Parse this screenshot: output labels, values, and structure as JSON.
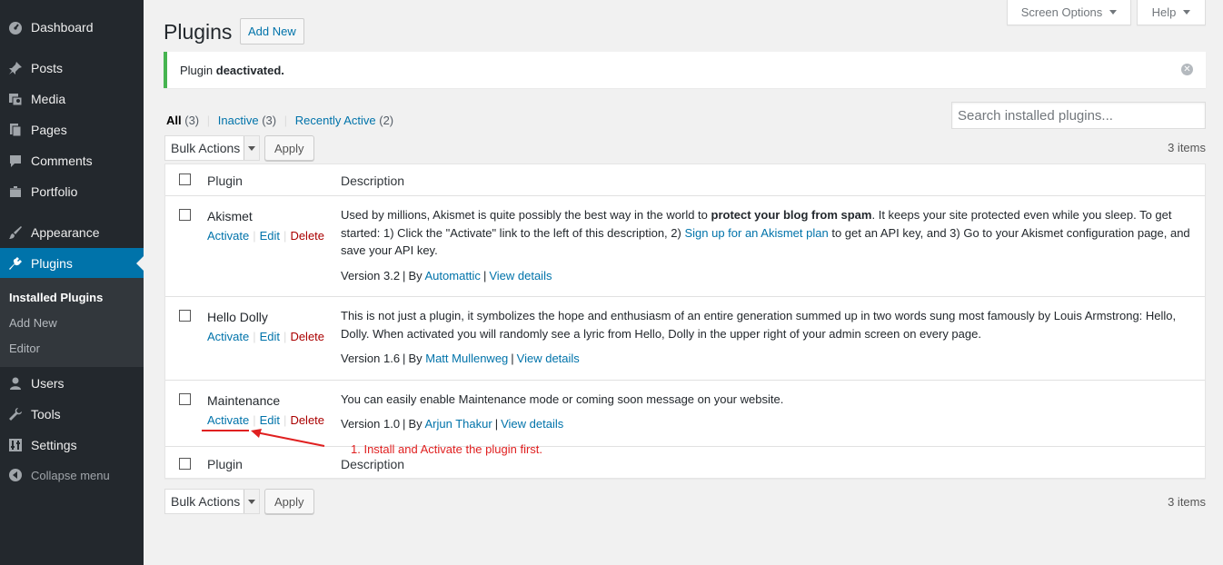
{
  "sidebar": {
    "items": [
      {
        "label": "Dashboard",
        "icon": "dashboard-icon"
      },
      {
        "label": "Posts",
        "icon": "pin-icon"
      },
      {
        "label": "Media",
        "icon": "media-icon"
      },
      {
        "label": "Pages",
        "icon": "pages-icon"
      },
      {
        "label": "Comments",
        "icon": "comments-icon"
      },
      {
        "label": "Portfolio",
        "icon": "portfolio-icon"
      },
      {
        "label": "Appearance",
        "icon": "brush-icon"
      },
      {
        "label": "Plugins",
        "icon": "plug-icon"
      },
      {
        "label": "Users",
        "icon": "users-icon"
      },
      {
        "label": "Tools",
        "icon": "wrench-icon"
      },
      {
        "label": "Settings",
        "icon": "settings-icon"
      },
      {
        "label": "Collapse menu",
        "icon": "collapse-icon"
      }
    ],
    "submenu": [
      "Installed Plugins",
      "Add New",
      "Editor"
    ]
  },
  "header": {
    "screen_options": "Screen Options",
    "help": "Help",
    "title": "Plugins",
    "add_new": "Add New"
  },
  "notice": {
    "prefix": "Plugin",
    "strong": "deactivated."
  },
  "filters": {
    "all": "All",
    "all_count": "(3)",
    "inactive": "Inactive",
    "inactive_count": "(3)",
    "recent": "Recently Active",
    "recent_count": "(2)",
    "sep": "|"
  },
  "search": {
    "placeholder": "Search installed plugins..."
  },
  "bulk": {
    "label": "Bulk Actions",
    "apply": "Apply",
    "items": "3 items"
  },
  "table": {
    "col_plugin": "Plugin",
    "col_description": "Description",
    "actions": {
      "activate": "Activate",
      "edit": "Edit",
      "delete": "Delete",
      "sep": "|"
    },
    "by": "By",
    "view_details": "View details",
    "plugins": [
      {
        "name": "Akismet",
        "desc_a": "Used by millions, Akismet is quite possibly the best way in the world to ",
        "desc_strong": "protect your blog from spam",
        "desc_b": ". It keeps your site protected even while you sleep. To get started: 1) Click the \"Activate\" link to the left of this description, 2) ",
        "desc_link": "Sign up for an Akismet plan",
        "desc_c": " to get an API key, and 3) Go to your Akismet configuration page, and save your API key.",
        "version": "Version 3.2",
        "author": "Automattic"
      },
      {
        "name": "Hello Dolly",
        "desc_a": "This is not just a plugin, it symbolizes the hope and enthusiasm of an entire generation summed up in two words sung most famously by Louis Armstrong: Hello, Dolly. When activated you will randomly see a lyric from Hello, Dolly in the upper right of your admin screen on every page.",
        "version": "Version 1.6",
        "author": "Matt Mullenweg"
      },
      {
        "name": "Maintenance",
        "desc_a": "You can easily enable Maintenance mode or coming soon message on your website.",
        "version": "Version 1.0",
        "author": "Arjun Thakur"
      }
    ]
  },
  "annotation": "1. Install and Activate the plugin first.",
  "colors": {
    "accent": "#0073aa",
    "sidebar": "#23282d",
    "notice": "#46b450",
    "annotation": "#e02020",
    "delete": "#a00"
  }
}
